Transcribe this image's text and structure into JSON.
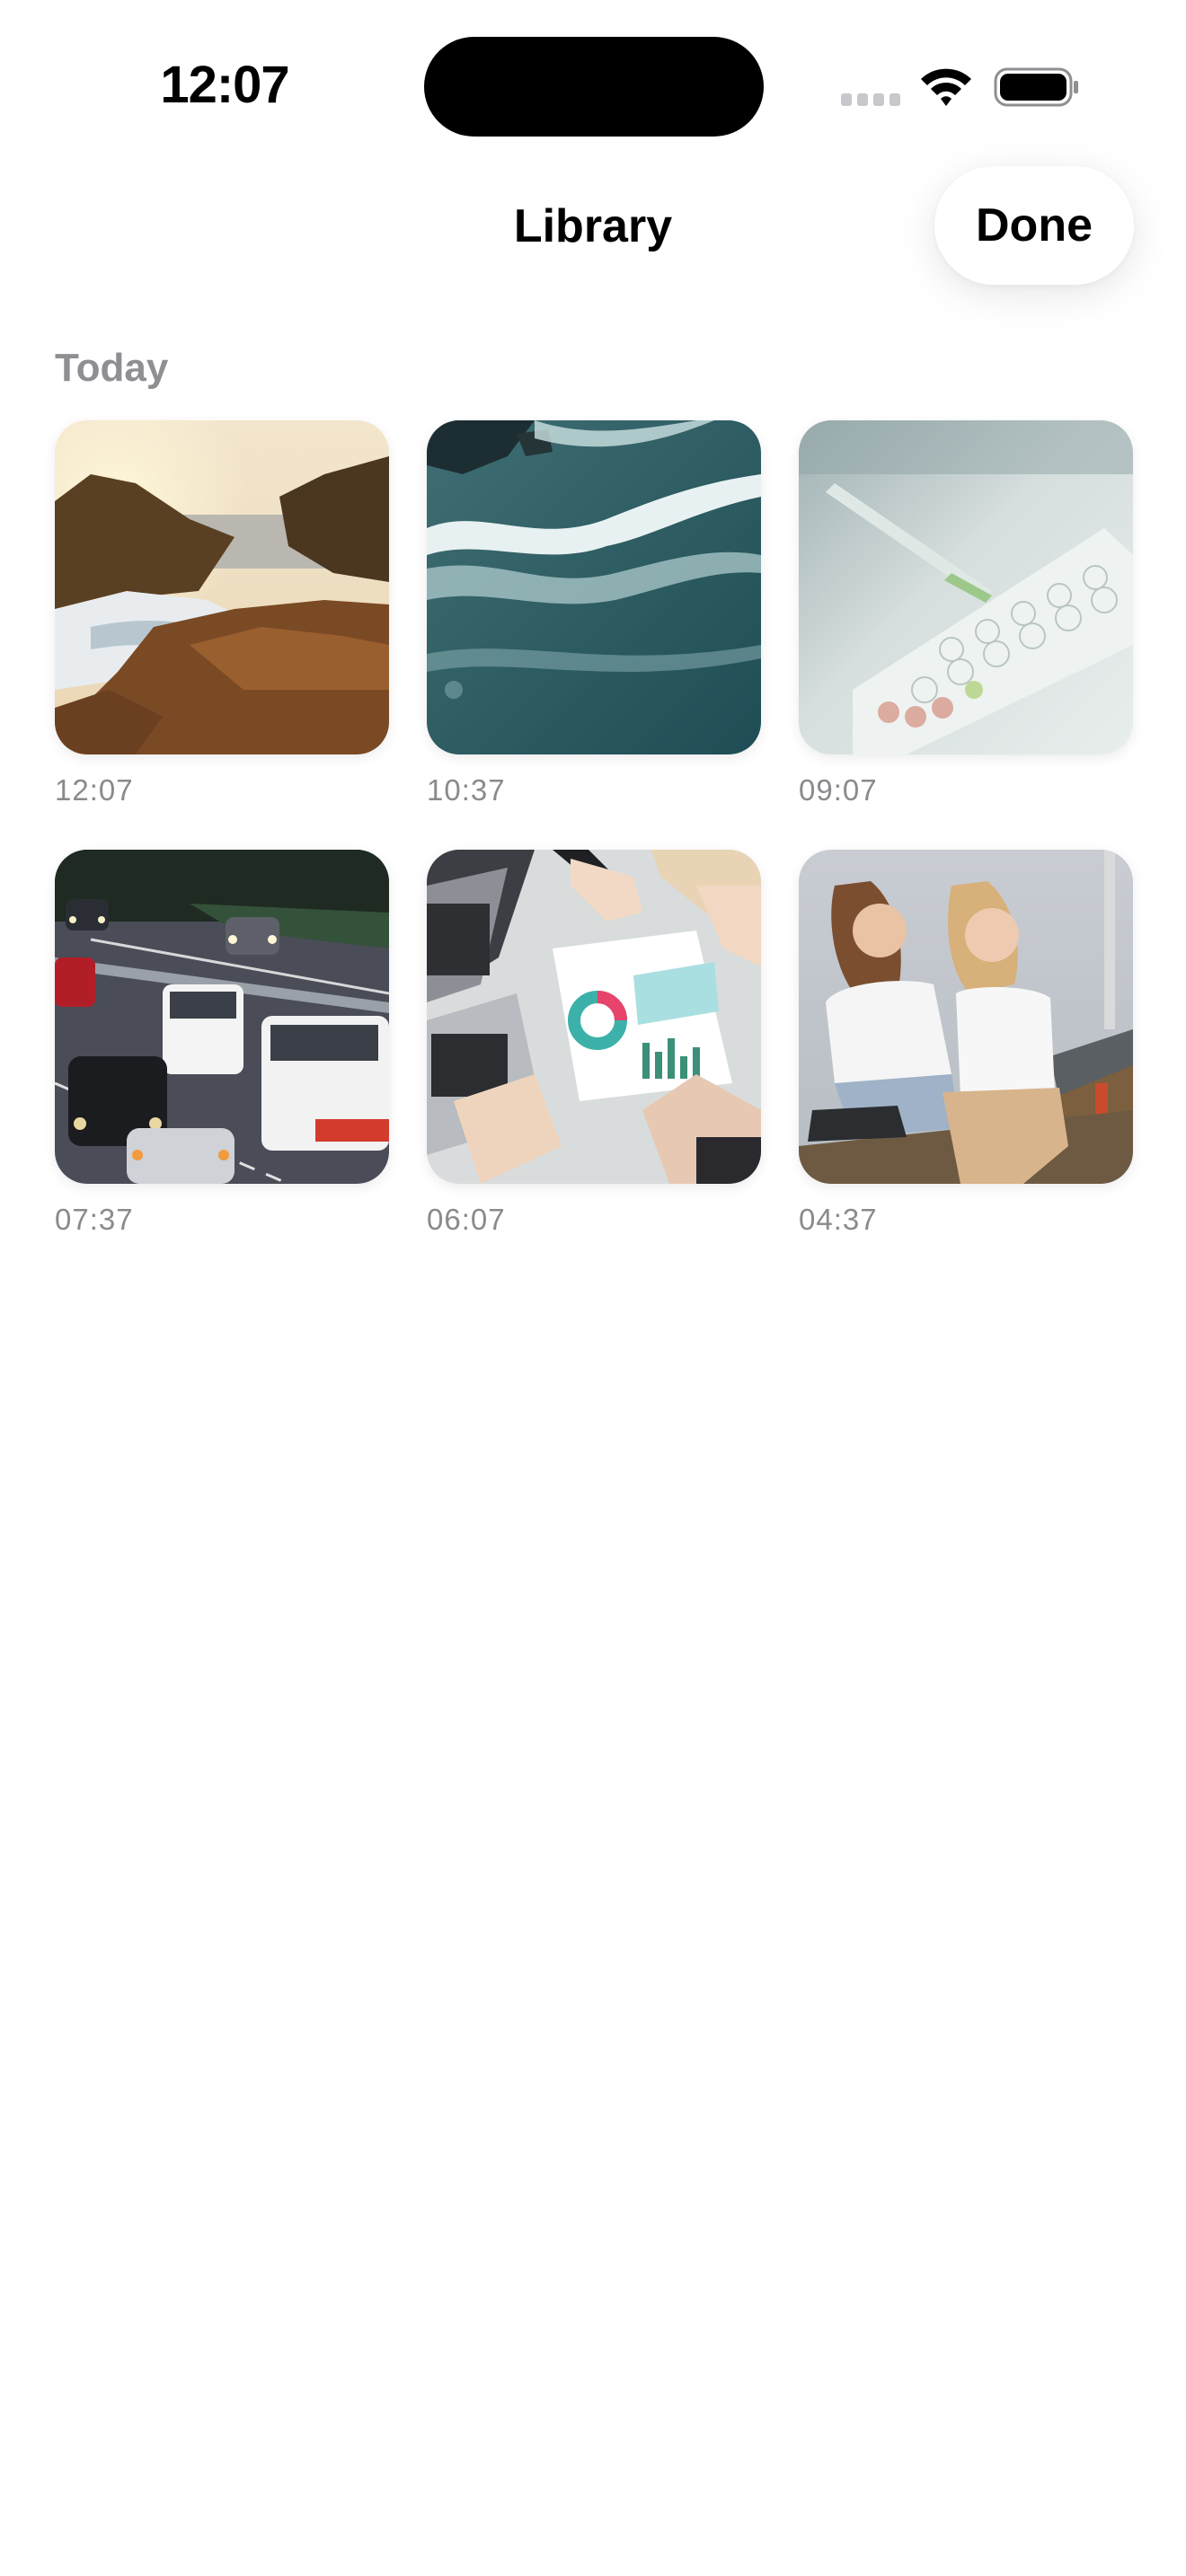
{
  "status_bar": {
    "time": "12:07",
    "icons": [
      "cellular-signal-icon",
      "wifi-icon",
      "battery-icon"
    ]
  },
  "nav": {
    "title": "Library",
    "done_label": "Done"
  },
  "section": {
    "header": "Today",
    "items": [
      {
        "time": "12:07",
        "thumbnail": "rocky-coast-sunset"
      },
      {
        "time": "10:37",
        "thumbnail": "aerial-ocean-waves"
      },
      {
        "time": "09:07",
        "thumbnail": "lab-pipette-well-plate"
      },
      {
        "time": "07:37",
        "thumbnail": "highway-traffic-vans"
      },
      {
        "time": "06:07",
        "thumbnail": "office-desk-laptops-charts"
      },
      {
        "time": "04:37",
        "thumbnail": "two-women-outdoors"
      }
    ]
  },
  "colors": {
    "background": "#ffffff",
    "text_primary": "#000000",
    "text_secondary": "#8e8e93"
  }
}
